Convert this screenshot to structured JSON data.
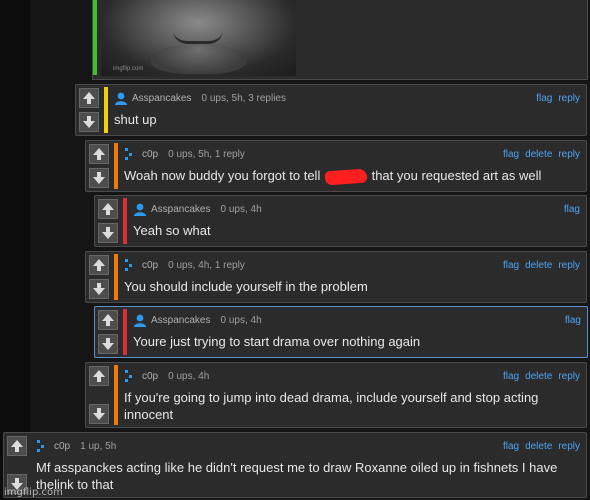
{
  "image_post": {
    "watermark": "imgflip.com"
  },
  "colors": {
    "green": "#3fc12a",
    "yellow": "#f2d00c",
    "orange": "#f07a0c",
    "red": "#d63030",
    "link": "#4ea3f0",
    "accent_border": "#5a8fd1"
  },
  "comments": [
    {
      "username": "Asspancakes",
      "stats": "0 ups, 5h, 3 replies",
      "actions": [
        "flag",
        "reply"
      ],
      "text": "shut up",
      "bar_color": "yellow",
      "avatar": "person-icon"
    },
    {
      "username": "c0p",
      "stats": "0 ups, 5h, 1 reply",
      "actions": [
        "flag",
        "delete",
        "reply"
      ],
      "text_before": "Woah now buddy you forgot to tell",
      "text_after": "that you requested art as well",
      "bar_color": "orange",
      "avatar": "pixel-avatar-icon"
    },
    {
      "username": "Asspancakes",
      "stats": "0 ups, 4h",
      "actions": [
        "flag"
      ],
      "text": "Yeah so what",
      "bar_color": "red",
      "avatar": "person-icon"
    },
    {
      "username": "c0p",
      "stats": "0 ups, 4h, 1 reply",
      "actions": [
        "flag",
        "delete",
        "reply"
      ],
      "text": "You should include yourself in the problem",
      "bar_color": "orange",
      "avatar": "pixel-avatar-icon"
    },
    {
      "username": "Asspancakes",
      "stats": "0 ups, 4h",
      "actions": [
        "flag"
      ],
      "text": "Youre just trying to start drama over nothing again",
      "bar_color": "red",
      "avatar": "person-icon"
    },
    {
      "username": "c0p",
      "stats": "0 ups, 4h",
      "actions": [
        "flag",
        "delete",
        "reply"
      ],
      "text": "If you're going to jump into dead drama, include yourself and stop acting innocent",
      "bar_color": "orange",
      "avatar": "pixel-avatar-icon"
    },
    {
      "username": "c0p",
      "stats": "1 up, 5h",
      "actions": [
        "flag",
        "delete",
        "reply"
      ],
      "text": "Mf asspanckes acting like he didn't request me to draw Roxanne oiled up in fishnets I have thelink to that",
      "bar_color": "none",
      "avatar": "pixel-avatar-icon"
    }
  ]
}
